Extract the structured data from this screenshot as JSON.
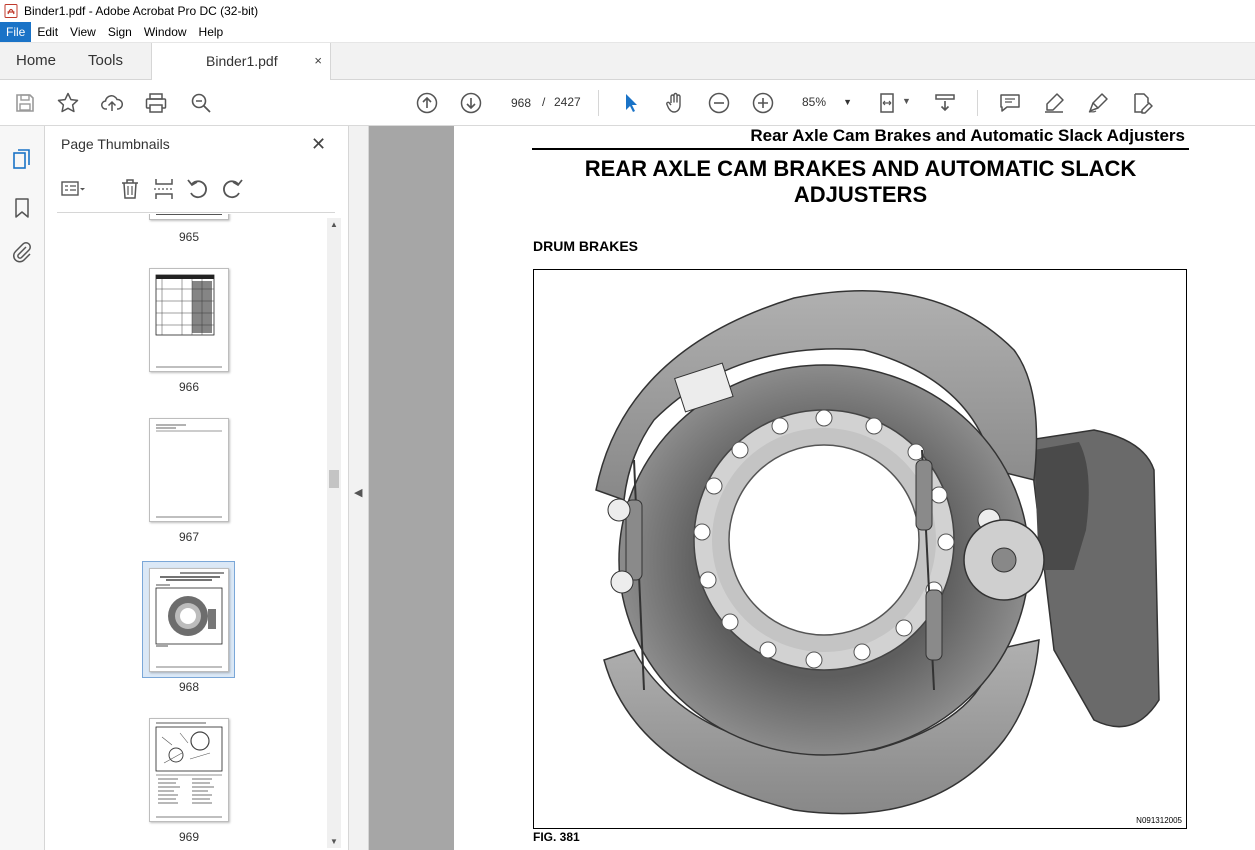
{
  "window": {
    "title": "Binder1.pdf - Adobe Acrobat Pro DC (32-bit)"
  },
  "menu": {
    "items": [
      "File",
      "Edit",
      "View",
      "Sign",
      "Window",
      "Help"
    ]
  },
  "tabs": {
    "home": "Home",
    "tools": "Tools",
    "document": "Binder1.pdf",
    "close": "×"
  },
  "toolbar": {
    "current_page": "968",
    "page_separator": "/",
    "total_pages": "2427",
    "zoom": "85%"
  },
  "panel": {
    "title": "Page Thumbnails",
    "close": "✕",
    "thumbnails": [
      {
        "label": "965"
      },
      {
        "label": "966"
      },
      {
        "label": "967"
      },
      {
        "label": "968",
        "selected": true
      },
      {
        "label": "969"
      }
    ]
  },
  "document": {
    "running_head": "Rear Axle Cam Brakes and Automatic Slack Adjusters",
    "title_line1": "REAR AXLE CAM BRAKES AND AUTOMATIC SLACK",
    "title_line2": "ADJUSTERS",
    "section_heading": "DRUM BRAKES",
    "figure_id": "N091312005",
    "figure_caption": "FIG. 381"
  },
  "colors": {
    "menu_active": "#1a73c7",
    "accent_blue": "#1a73c7",
    "doc_background": "#a6a6a6"
  }
}
